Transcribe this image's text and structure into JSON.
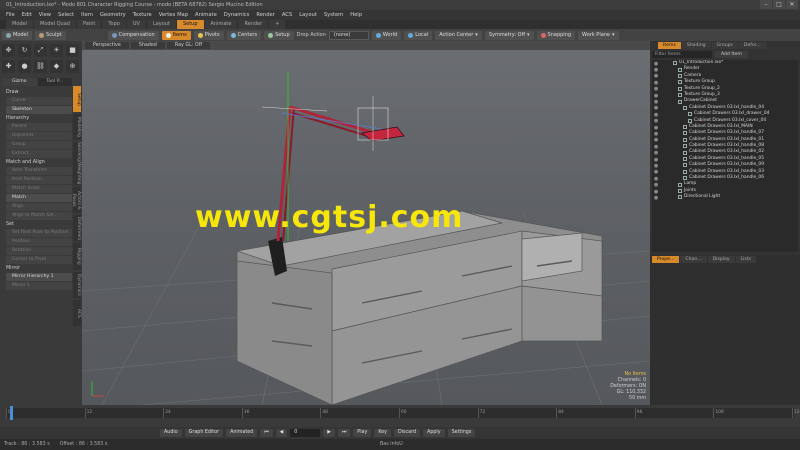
{
  "window": {
    "title": "01_Introduction.lxo* - Modo 801 Character Rigging Course - modo (BETA 68782) Sergio Mucino Edition",
    "controls": [
      "–",
      "□",
      "✕"
    ]
  },
  "menubar": [
    "File",
    "Edit",
    "View",
    "Select",
    "Item",
    "Geometry",
    "Texture",
    "Vertex Map",
    "Animate",
    "Dynamics",
    "Render",
    "ACS",
    "Layout",
    "System",
    "Help"
  ],
  "layout_tabs": [
    {
      "label": "Model",
      "active": false
    },
    {
      "label": "Model Quad",
      "active": false
    },
    {
      "label": "Paint",
      "active": false
    },
    {
      "label": "Topo",
      "active": false
    },
    {
      "label": "UV",
      "active": false
    },
    {
      "label": "Layout",
      "active": false
    },
    {
      "label": "Setup",
      "active": true
    },
    {
      "label": "Animate",
      "active": false
    },
    {
      "label": "Render",
      "active": false
    },
    {
      "label": "+",
      "active": false
    }
  ],
  "toolbar": {
    "model": "Model",
    "sculpt": "Sculpt",
    "compensation": "Compensation",
    "items": "Items",
    "pivots": "Pivots",
    "centers": "Centers",
    "setup": "Setup",
    "drop_action_label": "Drop Action",
    "drop_action_value": "(none)",
    "world": "World",
    "local": "Local",
    "action_center": "Action Center",
    "symmetry": "Symmetry: Off",
    "snapping": "Snapping",
    "work_plane": "Work Plane"
  },
  "left_panel": {
    "tabs": [
      "Gizmo",
      "Tool P..."
    ],
    "groups": [
      {
        "name": "Draw",
        "items": [
          {
            "label": "Curve",
            "on": false
          },
          {
            "label": "Skeleton",
            "on": true
          }
        ]
      },
      {
        "name": "Hierarchy",
        "items": [
          {
            "label": "Parent",
            "on": false
          },
          {
            "label": "Unparent",
            "on": false
          },
          {
            "label": "Group",
            "on": false
          },
          {
            "label": "Extract",
            "on": false
          }
        ]
      },
      {
        "name": "Match and Align",
        "items": [
          {
            "label": "Item Transform",
            "on": false
          },
          {
            "label": "Item Position",
            "on": false
          },
          {
            "label": "Match Scale",
            "on": false
          },
          {
            "label": "Match",
            "on": true
          }
        ]
      },
      {
        "name": "",
        "items": [
          {
            "label": "Align",
            "on": false
          },
          {
            "label": "Align to Match Sel...",
            "on": false
          }
        ]
      },
      {
        "name": "Set",
        "items": [
          {
            "label": "Set Rest Pose to Position",
            "on": false
          }
        ]
      },
      {
        "name": "",
        "items": [
          {
            "label": "Position",
            "on": false
          },
          {
            "label": "Rotation",
            "on": false
          }
        ]
      },
      {
        "name": "",
        "items": [
          {
            "label": "Center to Pivot",
            "on": false
          }
        ]
      },
      {
        "name": "Mirror",
        "items": [
          {
            "label": "Mirror Hierarchy 1",
            "on": true
          },
          {
            "label": "Mirror 1",
            "on": false
          }
        ]
      }
    ],
    "vertical_tabs": [
      {
        "label": "Setup",
        "active": true
      },
      {
        "label": "Modeling",
        "active": false
      },
      {
        "label": "Skinning/Weighting",
        "active": false
      },
      {
        "label": "Actors & Poses",
        "active": false
      },
      {
        "label": "Deformers",
        "active": false
      },
      {
        "label": "Rigging",
        "active": false
      },
      {
        "label": "Dynamics",
        "active": false
      },
      {
        "label": "ACS",
        "active": false
      }
    ]
  },
  "viewport": {
    "header": [
      "Perspective",
      "Shaded",
      "Ray GL: Off"
    ],
    "watermark": "www.cgtsj.com",
    "stats": {
      "no_items": "No Items",
      "channels": "Channels: 0",
      "deformers": "Deformers: ON",
      "gl": "GL: 110,332",
      "scale": "50 mm"
    }
  },
  "right_panel": {
    "tabs": [
      {
        "label": "Items",
        "active": true
      },
      {
        "label": "Shading",
        "active": false
      },
      {
        "label": "Groups",
        "active": false
      },
      {
        "label": "Defor...",
        "active": false
      }
    ],
    "filter_label": "Filter Items",
    "add_item": "Add Item",
    "items": [
      {
        "label": "01_Introduction.lxo*",
        "indent": 0,
        "hi": false
      },
      {
        "label": "Render",
        "indent": 1,
        "hi": false
      },
      {
        "label": "Camera",
        "indent": 1,
        "hi": false
      },
      {
        "label": "Texture Group",
        "indent": 1,
        "hi": false
      },
      {
        "label": "Texture Group_2",
        "indent": 1,
        "hi": false
      },
      {
        "label": "Texture Group_3",
        "indent": 1,
        "hi": false
      },
      {
        "label": "DrawerCabinet",
        "indent": 1,
        "hi": false
      },
      {
        "label": "Cabinet Drawers 03.lxl_handle_04",
        "indent": 2,
        "hi": false
      },
      {
        "label": "Cabinet Drawers 03.lxl_drawer_04",
        "indent": 3,
        "hi": false
      },
      {
        "label": "Cabinet Drawers 03.lxl_cover_04",
        "indent": 3,
        "hi": false
      },
      {
        "label": "Cabinet Drawers 03.lxl_MAIN",
        "indent": 2,
        "hi": false
      },
      {
        "label": "Cabinet Drawers 03.lxl_handle_07",
        "indent": 2,
        "hi": false
      },
      {
        "label": "Cabinet Drawers 03.lxl_handle_01",
        "indent": 2,
        "hi": false
      },
      {
        "label": "Cabinet Drawers 03.lxl_handle_08",
        "indent": 2,
        "hi": false
      },
      {
        "label": "Cabinet Drawers 03.lxl_handle_02",
        "indent": 2,
        "hi": false
      },
      {
        "label": "Cabinet Drawers 03.lxl_handle_05",
        "indent": 2,
        "hi": false
      },
      {
        "label": "Cabinet Drawers 03.lxl_handle_09",
        "indent": 2,
        "hi": false
      },
      {
        "label": "Cabinet Drawers 03.lxl_handle_03",
        "indent": 2,
        "hi": false
      },
      {
        "label": "Cabinet Drawers 03.lxl_handle_06",
        "indent": 2,
        "hi": false
      },
      {
        "label": "Lamp",
        "indent": 1,
        "hi": false
      },
      {
        "label": "Joints",
        "indent": 1,
        "hi": false
      },
      {
        "label": "Directional Light",
        "indent": 1,
        "hi": false
      }
    ],
    "prop_tabs": [
      {
        "label": "Prope...",
        "active": true
      },
      {
        "label": "Chan...",
        "active": false
      },
      {
        "label": "Display",
        "active": false
      },
      {
        "label": "Lists",
        "active": false
      }
    ]
  },
  "timeline": {
    "ticks": [
      "0",
      "12",
      "24",
      "36",
      "48",
      "60",
      "72",
      "84",
      "96",
      "108",
      "120"
    ]
  },
  "transport": {
    "audio": "Audio",
    "graph_editor": "Graph Editor",
    "animated": "Animated",
    "frame": "0",
    "play": "Play",
    "key": "Key",
    "discard": "Discard",
    "apply": "Apply",
    "settings": "Settings"
  },
  "statusbar": {
    "track": "Track : 86 : 3.583 s",
    "offset": "Offset : 86 : 3.583 s",
    "center": "Bas infoU"
  }
}
